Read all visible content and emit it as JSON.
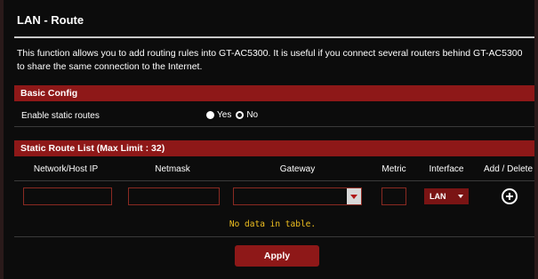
{
  "page": {
    "title": "LAN - Route",
    "description": "This function allows you to add routing rules into GT-AC5300. It is useful if you connect several routers behind GT-AC5300 to share the same connection to the Internet."
  },
  "basic_config": {
    "header": "Basic Config",
    "enable_label": "Enable static routes",
    "options": [
      {
        "label": "Yes",
        "checked": false
      },
      {
        "label": "No",
        "checked": true
      }
    ]
  },
  "route_list": {
    "header": "Static Route List (Max Limit : 32)",
    "columns": [
      "Network/Host IP",
      "Netmask",
      "Gateway",
      "Metric",
      "Interface",
      "Add / Delete"
    ],
    "inputs": {
      "network_value": "",
      "netmask_value": "",
      "gateway_value": "",
      "metric_value": "",
      "interface_value": "LAN"
    },
    "empty_text": "No data in table."
  },
  "actions": {
    "apply_label": "Apply"
  },
  "colors": {
    "accent": "#8e1818",
    "background": "#0c0c0c",
    "notice": "#f0c020"
  }
}
